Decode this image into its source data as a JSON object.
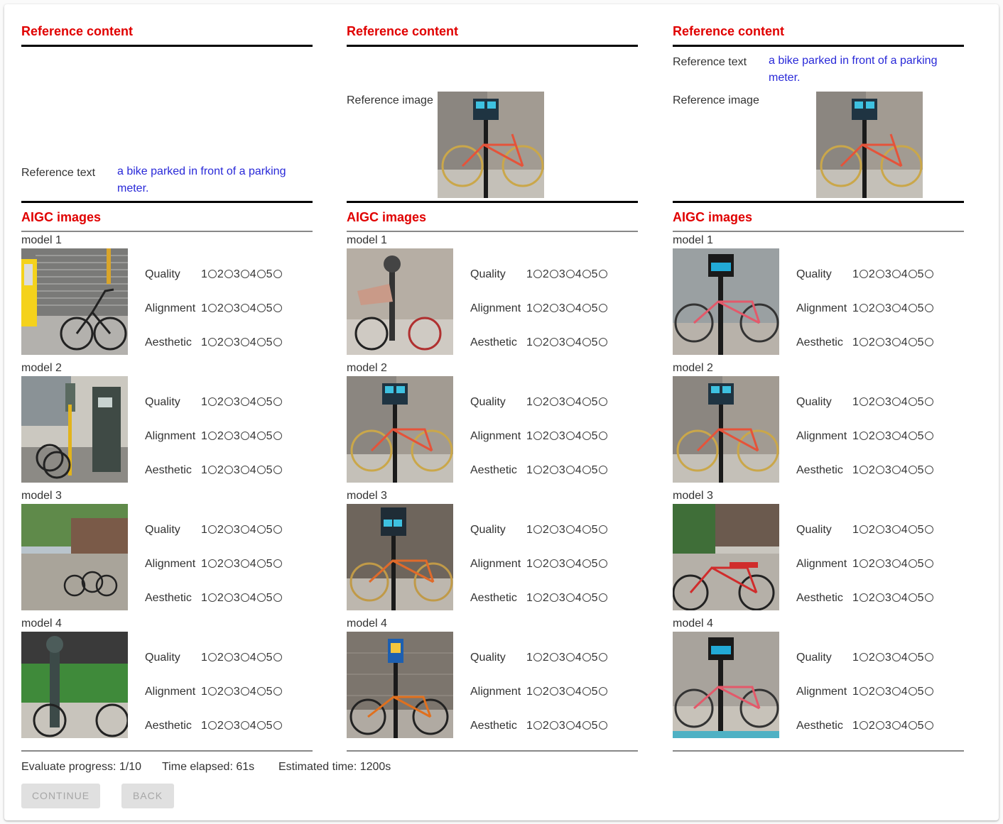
{
  "columns": [
    {
      "reference_title": "Reference content",
      "ref_text_label": "Reference text",
      "ref_text_value": "a bike parked in front of a parking meter.",
      "ref_image_label": "",
      "aigc_title": "AIGC images",
      "models": [
        {
          "label": "model 1",
          "image": "bike-by-yellow-meter-shutter"
        },
        {
          "label": "model 2",
          "image": "bike-by-parking-pay-machines"
        },
        {
          "label": "model 3",
          "image": "bikes-on-rack-city-street"
        },
        {
          "label": "model 4",
          "image": "bike-by-green-meter-hedge"
        }
      ]
    },
    {
      "reference_title": "Reference content",
      "ref_text_label": "",
      "ref_text_value": "",
      "ref_image_label": "Reference image",
      "aigc_title": "AIGC images",
      "models": [
        {
          "label": "model 1",
          "image": "bike-by-old-meter-debris"
        },
        {
          "label": "model 2",
          "image": "orange-bike-blue-meter"
        },
        {
          "label": "model 3",
          "image": "orange-bike-blue-meter-sidewalk"
        },
        {
          "label": "model 4",
          "image": "orange-bike-blue-sign-wall"
        }
      ]
    },
    {
      "reference_title": "Reference content",
      "ref_text_label": "Reference text",
      "ref_text_value": "a bike parked in front of a parking meter.",
      "ref_image_label": "Reference image",
      "aigc_title": "AIGC images",
      "models": [
        {
          "label": "model 1",
          "image": "pink-bike-black-meter"
        },
        {
          "label": "model 2",
          "image": "orange-bike-blue-meter"
        },
        {
          "label": "model 3",
          "image": "red-bike-tree-lined-street"
        },
        {
          "label": "model 4",
          "image": "pink-bike-black-meter-blue"
        }
      ]
    }
  ],
  "criteria": [
    "Quality",
    "Alignment",
    "Aesthetic"
  ],
  "scale": [
    "1",
    "2",
    "3",
    "4",
    "5"
  ],
  "footer": {
    "progress": "Evaluate progress: 1/10",
    "elapsed": "Time elapsed: 61s",
    "estimated": "Estimated time: 1200s"
  },
  "buttons": {
    "continue": "CONTINUE",
    "back": "BACK"
  },
  "colors": {
    "title": "#e00000",
    "ref_text": "#2828d8",
    "button_bg": "#e0e0e0",
    "button_text": "#a6a6a6"
  }
}
